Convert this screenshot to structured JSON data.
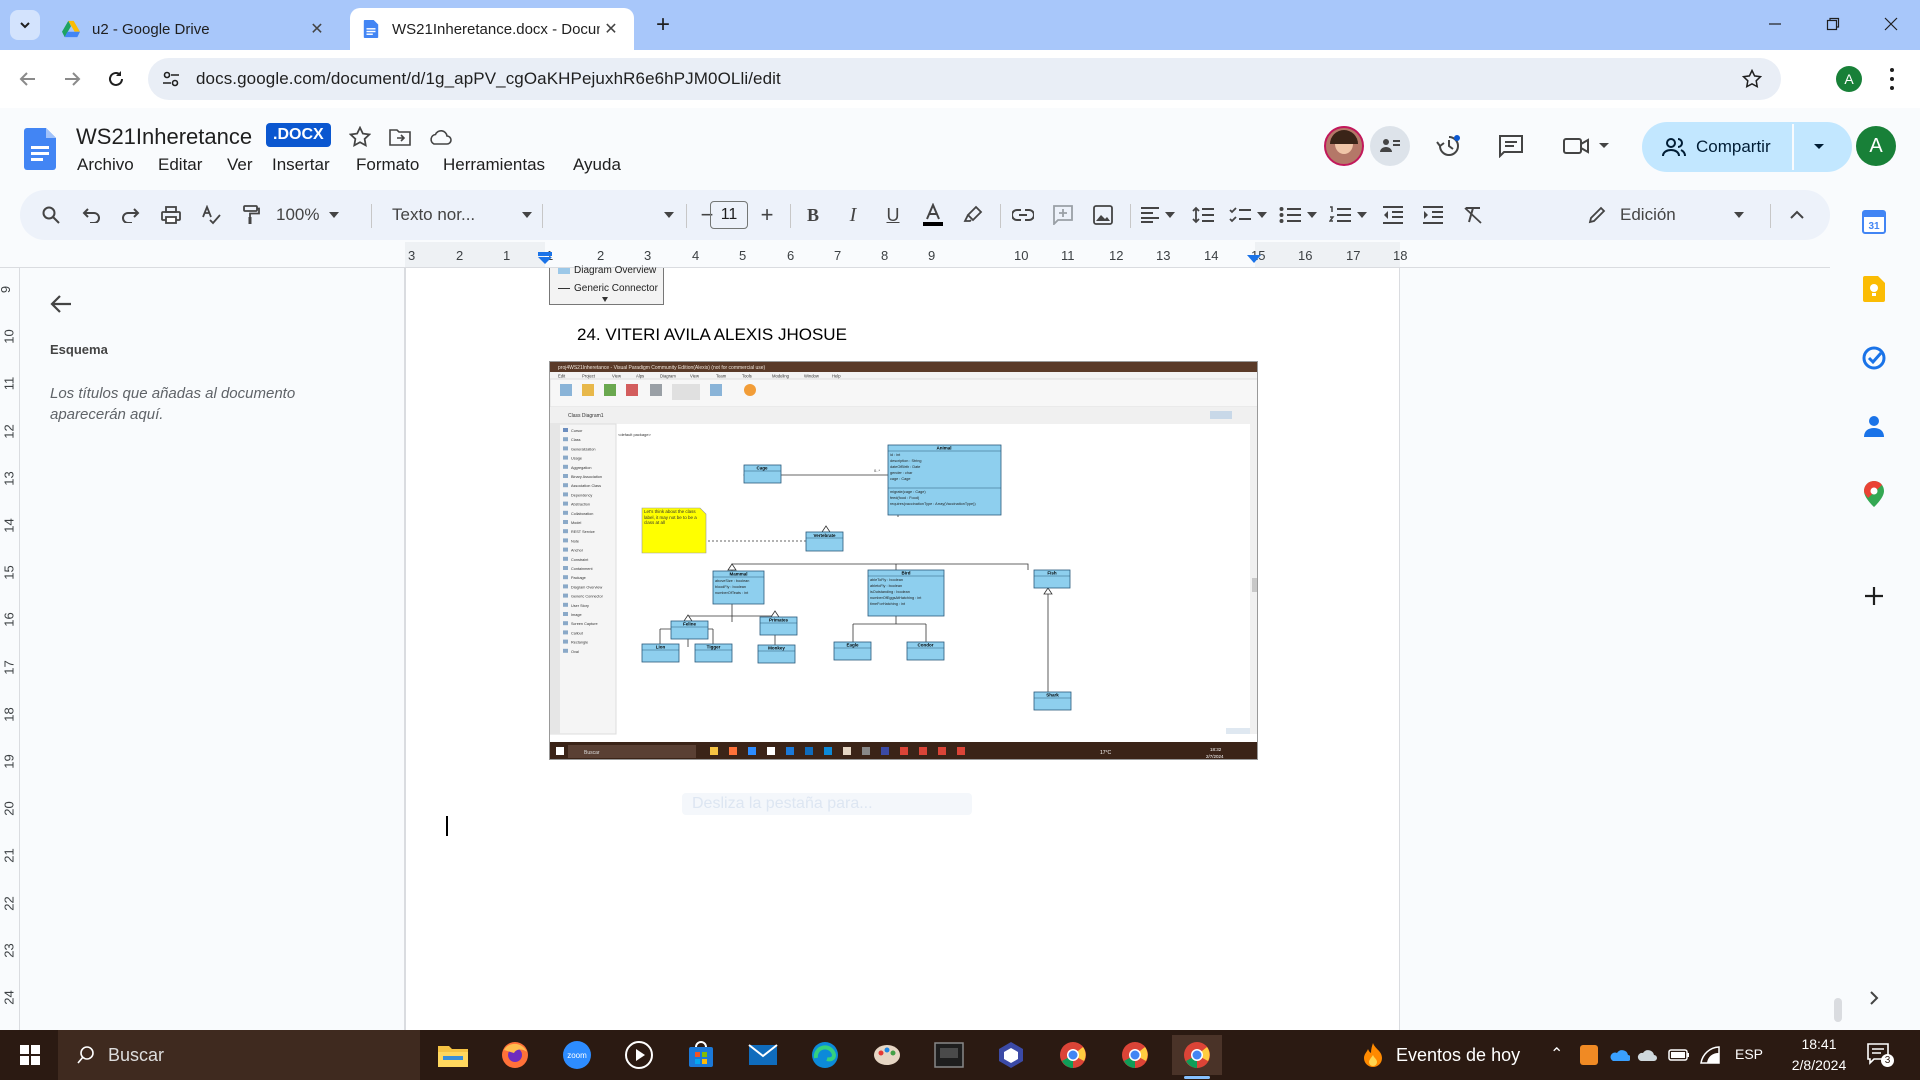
{
  "browser": {
    "tabs": [
      {
        "title": "u2 - Google Drive",
        "active": false
      },
      {
        "title": "WS21Inheretance.docx - Docum",
        "active": true
      }
    ],
    "url": "docs.google.com/document/d/1g_apPV_cgOaKHPejuxhR6e6hPJM0OLli/edit",
    "profile_initial": "A"
  },
  "doc": {
    "title": "WS21Inheretance",
    "badge": ".DOCX",
    "menus": [
      "Archivo",
      "Editar",
      "Ver",
      "Insertar",
      "Formato",
      "Herramientas",
      "Ayuda"
    ],
    "share_label": "Compartir",
    "user_initial": "A"
  },
  "toolbar": {
    "zoom": "100%",
    "style": "Texto nor...",
    "font": "",
    "font_size": "11",
    "mode": "Edición"
  },
  "ruler": {
    "horizontal": [
      "3",
      "2",
      "1",
      "1",
      "2",
      "3",
      "4",
      "5",
      "6",
      "7",
      "8",
      "9",
      "10",
      "11",
      "12",
      "13",
      "14",
      "15",
      "16",
      "17",
      "18"
    ],
    "vertical": [
      "9",
      "10",
      "11",
      "12",
      "13",
      "14",
      "15",
      "16",
      "17",
      "18",
      "19",
      "20",
      "21",
      "22",
      "23",
      "24"
    ]
  },
  "outline": {
    "title": "Esquema",
    "hint": "Los títulos que añadas al documento aparecerán aquí."
  },
  "page": {
    "prev_legend": [
      "Diagram Overview",
      "Generic Connector"
    ],
    "heading": "24. VITERI AVILA ALEXIS JHOSUE",
    "ghost_text": "Desliza la pestaña para..."
  },
  "screenshot": {
    "window_title": "proj4WS21Inheretance - Visual Paradigm Community Edition(Alexis) (not for commercial use)",
    "menu": [
      "Edit",
      "Project",
      "View",
      "Alps",
      "Diagram",
      "View",
      "Team",
      "Tools",
      "Modeling",
      "Window",
      "Help"
    ],
    "tab": "Class Diagram1",
    "package": "<default package>",
    "palette": [
      "Cursor",
      "Class",
      "Generalization",
      "Usage",
      "Aggregation",
      "Binary Association",
      "Association Class",
      "Dependency",
      "Abstraction",
      "Collaboration",
      "Model",
      "REST Service",
      "Note",
      "Anchor",
      "Constraint",
      "Containment",
      "Package",
      "Diagram Overview",
      "Generic Connector",
      "User Story",
      "Image",
      "Screen Capture",
      "Callout",
      "Rectangle",
      "Oval"
    ],
    "classes": {
      "animal": {
        "name": "Animal",
        "attrs": [
          "id : int",
          "description : String",
          "dateOfBirth : Date",
          "gender : char",
          "cage : Cage"
        ],
        "ops": [
          "migrate(cage : Cage)",
          "feed(food : Food)",
          "requires(vaccinationType : Array(VaccinationType))"
        ]
      },
      "cage": "Cage",
      "vertebrate": "Vertebrate",
      "mammal": {
        "name": "Mammal",
        "attrs": [
          "aboveSize : boolean",
          "bloodFly : boolean",
          "numberOfTeats : int"
        ]
      },
      "bird": {
        "name": "Bird",
        "attrs": [
          "ableToFly : boolean",
          "abletoFly : boolean",
          "isOutstanding : boolean",
          "numberOfEggsAtHatching : int",
          "timeForHatching : int"
        ]
      },
      "fish": "Fish",
      "feline": "Feline",
      "primates": "Primates",
      "lion": "Lion",
      "tiger": "Tigger",
      "monkey": "Monkey",
      "eagle": "Eagle",
      "condor": "Condor",
      "shark": "Shark"
    },
    "note": "Let's think about the class label, it may not be to be a class at all",
    "mult_left": "0..1",
    "mult_right": "0..*",
    "taskbar_search": "Buscar",
    "weather": "17°C",
    "clock": "18:32",
    "date": "2/7/2024"
  },
  "taskbar": {
    "search": "Buscar",
    "weather": "Eventos de hoy",
    "lang": "ESP",
    "time": "18:41",
    "date": "2/8/2024",
    "notifications": "3"
  }
}
